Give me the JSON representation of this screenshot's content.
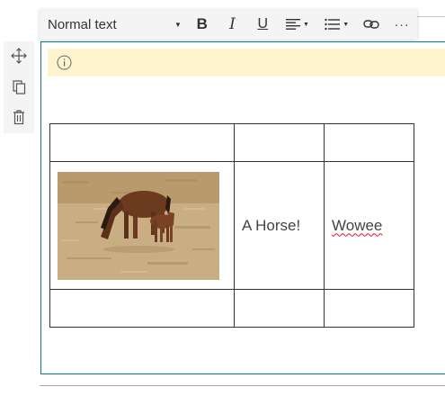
{
  "toolbar": {
    "text_style": "Normal text",
    "bold_icon": "bold-icon",
    "italic_icon": "italic-icon",
    "underline_icon": "underline-icon",
    "align_icon": "align-left-icon",
    "list_icon": "bulleted-list-icon",
    "link_icon": "link-icon",
    "more_icon": "more-options-icon",
    "bold_label": "B",
    "italic_label": "I",
    "underline_label": "U",
    "more_label": "···"
  },
  "side_toolbar": {
    "items": [
      "move-icon",
      "duplicate-icon",
      "delete-icon"
    ]
  },
  "info_bar": {
    "icon": "info-icon",
    "text": ""
  },
  "table": {
    "rows": [
      [
        "",
        "",
        ""
      ],
      [
        "[image: horse and foal grazing]",
        "A Horse!",
        "Wowee"
      ],
      [
        "",
        "",
        ""
      ]
    ],
    "image_alt": "Horse with foal grazing on dry grass"
  },
  "colors": {
    "toolbar_bg": "#f4f4f4",
    "section_border": "#0b7a85",
    "info_bar_bg": "#fff4ce",
    "table_border": "#333333",
    "spellcheck_underline": "#e81123"
  }
}
